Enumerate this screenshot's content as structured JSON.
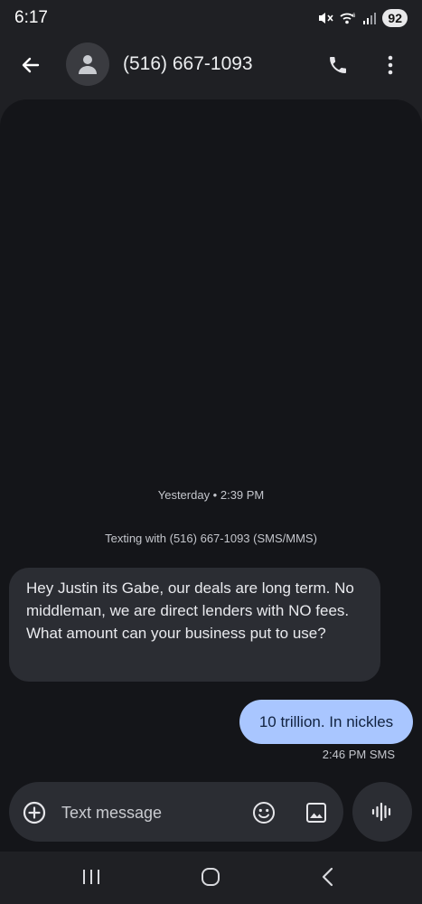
{
  "status_bar": {
    "time": "6:17",
    "battery": "92",
    "icons": [
      "mute-icon",
      "wifi-icon",
      "signal-icon"
    ]
  },
  "app_bar": {
    "contact": "(516) 667-1093",
    "icons": [
      "back-arrow-icon",
      "person-icon",
      "phone-icon",
      "more-vert-icon"
    ]
  },
  "conversation": {
    "timestamp": "Yesterday • 2:39 PM",
    "texting_with": "Texting with (516) 667-1093 (SMS/MMS)",
    "incoming_message": "Hey Justin its Gabe, our deals are long term. No middleman, we are direct lenders with NO fees. What amount can your business put to use?",
    "outgoing_message": "10 trillion. In nickles",
    "outgoing_time": "2:46 PM",
    "outgoing_type": "SMS"
  },
  "compose": {
    "placeholder": "Text message",
    "icons": [
      "add-circle-icon",
      "emoji-icon",
      "gallery-icon",
      "voice-waveform-icon"
    ]
  },
  "nav_bar": {
    "icons": [
      "recents-icon",
      "home-icon",
      "back-icon"
    ]
  },
  "colors": {
    "background": "#1f2024",
    "chat_background": "#141519",
    "incoming_bubble": "#2b2d33",
    "outgoing_bubble": "#a9c6ff"
  }
}
